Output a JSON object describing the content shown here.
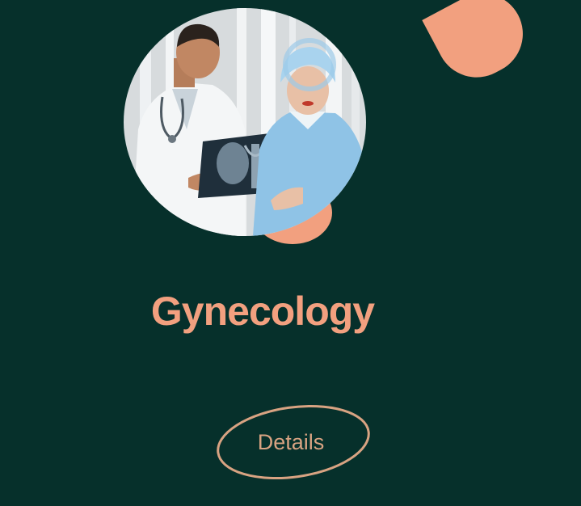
{
  "card": {
    "title": "Gynecology",
    "button_label": "Details",
    "photo_icon": "doctors-reviewing-xray-photo",
    "accent_color": "#f2a07f",
    "background_color": "#06302b"
  }
}
